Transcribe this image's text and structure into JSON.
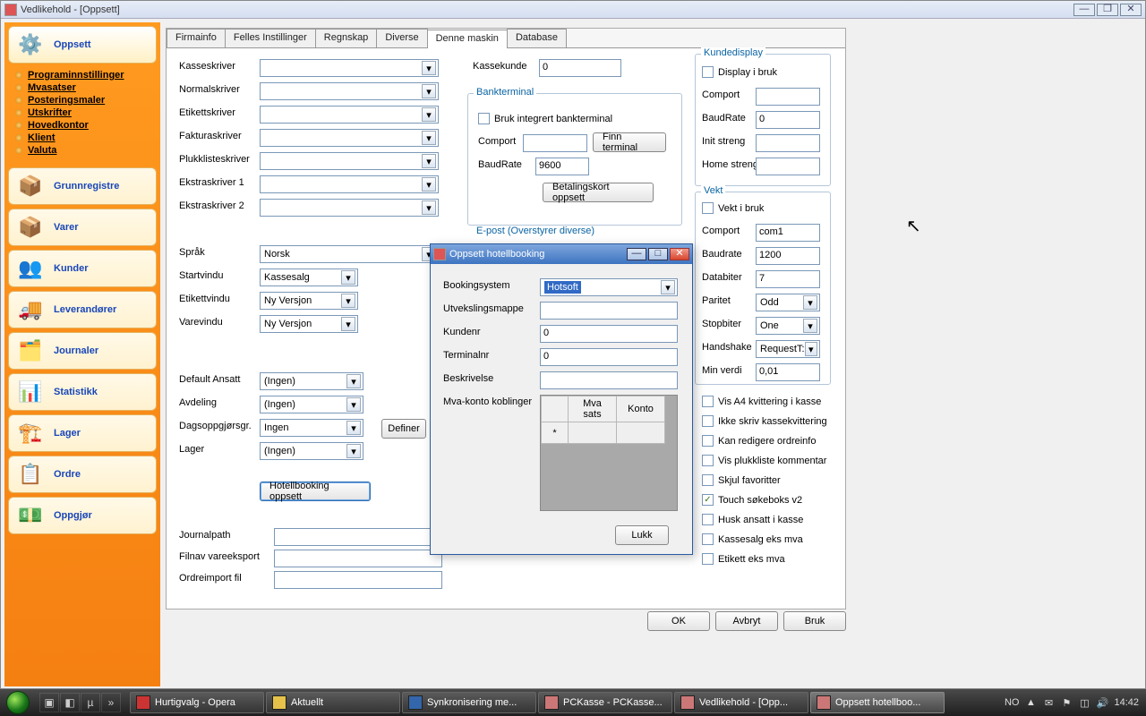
{
  "window": {
    "title": "Vedlikehold - [Oppsett]"
  },
  "sidebar": {
    "groups": [
      {
        "label": "Oppsett",
        "icon": "⚙️"
      },
      {
        "label": "Grunnregistre",
        "icon": "📦"
      },
      {
        "label": "Varer",
        "icon": "📦"
      },
      {
        "label": "Kunder",
        "icon": "👥"
      },
      {
        "label": "Leverandører",
        "icon": "🚚"
      },
      {
        "label": "Journaler",
        "icon": "🗂️"
      },
      {
        "label": "Statistikk",
        "icon": "📊"
      },
      {
        "label": "Lager",
        "icon": "🏗️"
      },
      {
        "label": "Ordre",
        "icon": "📋"
      },
      {
        "label": "Oppgjør",
        "icon": "💵"
      }
    ],
    "sub": [
      "Programinnstillinger",
      "Mvasatser",
      "Posteringsmaler",
      "Utskrifter",
      "Hovedkontor",
      "Klient",
      "Valuta"
    ]
  },
  "tabs": [
    "Firmainfo",
    "Felles Instillinger",
    "Regnskap",
    "Diverse",
    "Denne maskin",
    "Database"
  ],
  "labels": {
    "kasseskriver": "Kasseskriver",
    "normalskriver": "Normalskriver",
    "etikettskriver": "Etikettskriver",
    "fakturaskriver": "Fakturaskriver",
    "plukklisteskriver": "Plukklisteskriver",
    "ekstraskriver1": "Ekstraskriver 1",
    "ekstraskriver2": "Ekstraskriver 2",
    "sprak": "Språk",
    "startvindu": "Startvindu",
    "etikettvindu": "Etikettvindu",
    "varevindu": "Varevindu",
    "defaultansatt": "Default Ansatt",
    "avdeling": "Avdeling",
    "dagsoppgjor": "Dagsoppgjørsgr.",
    "lager": "Lager",
    "hotellbooking": "Hotellbooking oppsett",
    "definer": "Definer",
    "journalpath": "Journalpath",
    "filnavvareeksport": "Filnav vareeksport",
    "ordreimport": "Ordreimport fil",
    "kassekunde": "Kassekunde",
    "bankterminal": "Bankterminal",
    "brukintegrert": "Bruk integrert bankterminal",
    "comport": "Comport",
    "finnterminal": "Finn terminal",
    "baudrate": "BaudRate",
    "betalingskort": "Betalingskort oppsett",
    "epost": "E-post (Overstyrer diverse)",
    "kundedisplay": "Kundedisplay",
    "displayibruk": "Display i bruk",
    "initstreng": "Init streng",
    "homestreng": "Home streng",
    "vekt": "Vekt",
    "vektibruk": "Vekt i bruk",
    "baudrate2": "Baudrate",
    "databiter": "Databiter",
    "paritet": "Paritet",
    "stopbiter": "Stopbiter",
    "handshake": "Handshake",
    "minverdi": "Min verdi",
    "visa4": "Vis A4 kvittering i kasse",
    "ikkeskriv": "Ikke skriv kassekvittering",
    "kanredigere": "Kan redigere ordreinfo",
    "visplukkliste": "Vis plukkliste kommentar",
    "skjulfav": "Skjul favoritter",
    "touchsoke": "Touch søkeboks v2",
    "huskansatt": "Husk ansatt i kasse",
    "kassesalgeks": "Kassesalg eks mva",
    "etiketteks": "Etikett eks mva"
  },
  "values": {
    "sprak": "Norsk",
    "startvindu": "Kassesalg",
    "etikettvindu": "Ny Versjon",
    "varevindu": "Ny Versjon",
    "defaultansatt": "(Ingen)",
    "avdeling": "(Ingen)",
    "dagsoppgjor": "Ingen",
    "lager": "(Ingen)",
    "kassekunde": "0",
    "baudrate": "9600",
    "kd_baudrate": "0",
    "vekt_comport": "com1",
    "vekt_baudrate": "1200",
    "vekt_databiter": "7",
    "vekt_paritet": "Odd",
    "vekt_stopbiter": "One",
    "vekt_handshake": "RequestT:",
    "vekt_minverdi": "0,01"
  },
  "dialog": {
    "title": "Oppsett hotellbooking",
    "labels": {
      "bookingsystem": "Bookingsystem",
      "utvekslingsmappe": "Utvekslingsmappe",
      "kundenr": "Kundenr",
      "terminalnr": "Terminalnr",
      "beskrivelse": "Beskrivelse",
      "mvakonto": "Mva-konto koblinger",
      "lukk": "Lukk"
    },
    "values": {
      "bookingsystem": "Hotsoft",
      "kundenr": "0",
      "terminalnr": "0"
    },
    "table": {
      "h1": "Mva sats",
      "h2": "Konto",
      "row": "*"
    }
  },
  "buttons": {
    "ok": "OK",
    "avbryt": "Avbryt",
    "bruk": "Bruk"
  },
  "taskbar": {
    "tasks": [
      "Hurtigvalg - Opera",
      "Aktuellt",
      "Synkronisering me...",
      "PCKasse - PCKasse...",
      "Vedlikehold - [Opp...",
      "Oppsett hotellboo..."
    ],
    "lang": "NO",
    "time": "14:42"
  }
}
